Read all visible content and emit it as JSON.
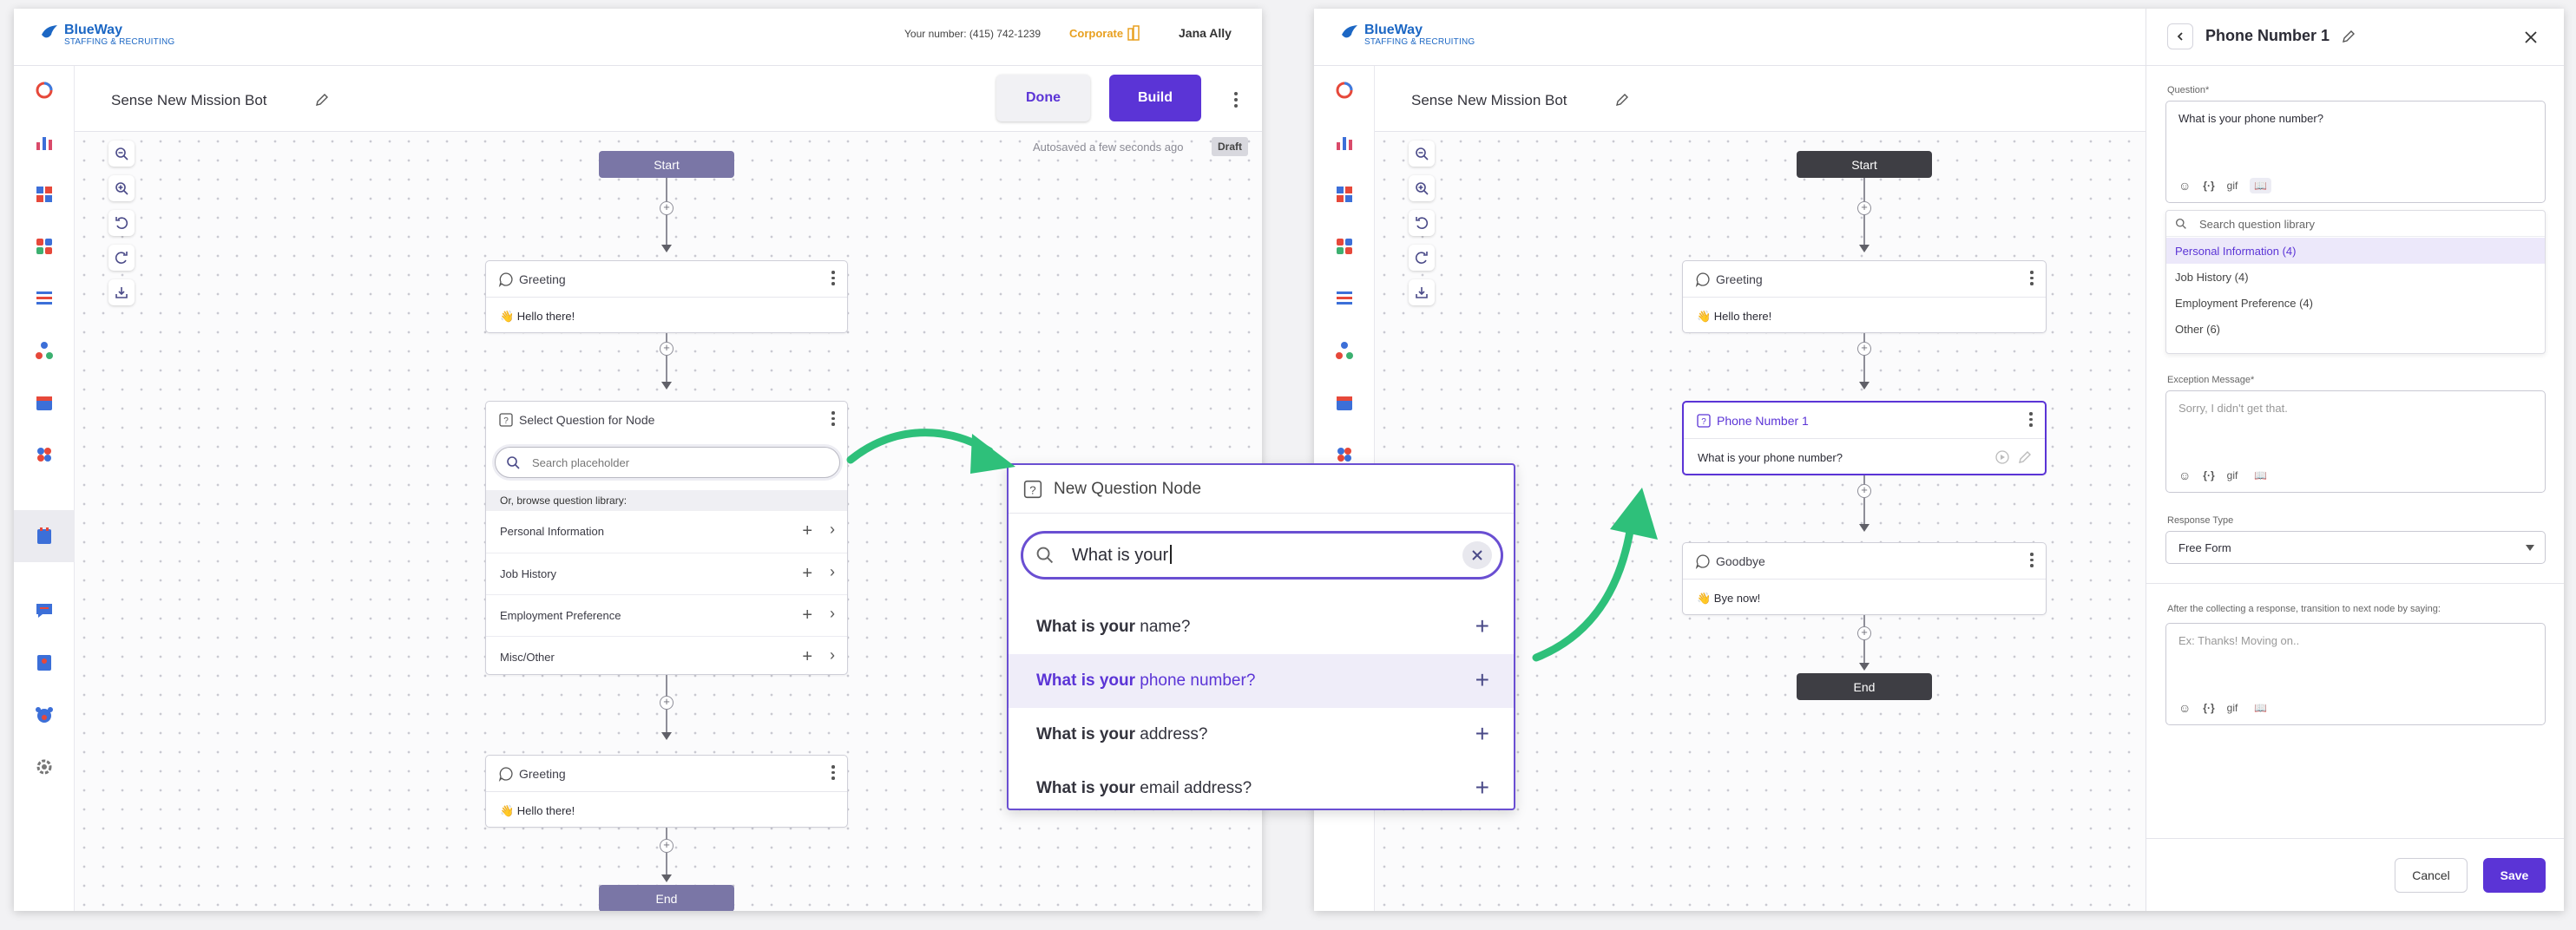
{
  "app": {
    "brand": "BlueWay",
    "brand_sub": "STAFFING & RECRUITING",
    "phone_label": "Your number: (415) 742-1239",
    "plan_badge": "Corporate",
    "user_name": "Jana Ally"
  },
  "bot": {
    "title": "Sense New Mission Bot",
    "done_label": "Done",
    "build_label": "Build",
    "autosave": "Autosaved a few seconds ago",
    "status_badge": "Draft"
  },
  "flow_left": {
    "start_label": "Start",
    "end_label": "End",
    "greeting1": {
      "title": "Greeting",
      "body": "👋 Hello there!"
    },
    "select_node": {
      "title": "Select Question for Node",
      "search_placeholder": "Search placeholder",
      "browse_label": "Or, browse question library:",
      "categories": [
        "Personal Information",
        "Job History",
        "Employment Preference",
        "Misc/Other"
      ]
    },
    "greeting2": {
      "title": "Greeting",
      "body": "👋 Hello there!"
    }
  },
  "popup": {
    "title": "New Question Node",
    "search_value": "What is your",
    "suggestions": [
      {
        "bold": "What is your",
        "rest": " name?"
      },
      {
        "bold": "What is your",
        "rest": " phone number?"
      },
      {
        "bold": "What is your",
        "rest": " address?"
      },
      {
        "bold": "What is your",
        "rest": " email address?"
      }
    ]
  },
  "flow_right": {
    "start_label": "Start",
    "end_label": "End",
    "greeting": {
      "title": "Greeting",
      "body": "👋 Hello there!"
    },
    "phone_node": {
      "title": "Phone Number 1",
      "body": "What is your phone number?"
    },
    "goodbye": {
      "title": "Goodbye",
      "body": "👋 Bye now!"
    }
  },
  "panel": {
    "title": "Phone Number 1",
    "question_label": "Question*",
    "question_value": "What is your phone number?",
    "library_search_placeholder": "Search question library",
    "library_items": [
      "Personal Information (4)",
      "Job History (4)",
      "Employment Preference (4)",
      "Other (6)"
    ],
    "exception_label": "Exception Message*",
    "exception_placeholder": "Sorry, I didn't get that.",
    "response_type_label": "Response Type",
    "response_type_value": "Free Form",
    "transition_label": "After the collecting a response, transition to next node by saying:",
    "transition_placeholder": "Ex: Thanks! Moving on..",
    "toolbar_gif": "gif",
    "toolbar_var": "{·}",
    "cancel_label": "Cancel",
    "save_label": "Save"
  },
  "colors": {
    "accent": "#5b34d6",
    "node_pill_left": "#7a76a6",
    "node_pill_right": "#3e3e44",
    "green_arrow": "#2ec07a",
    "brand_blue": "#1c67c4",
    "corporate_orange": "#e8a020"
  }
}
